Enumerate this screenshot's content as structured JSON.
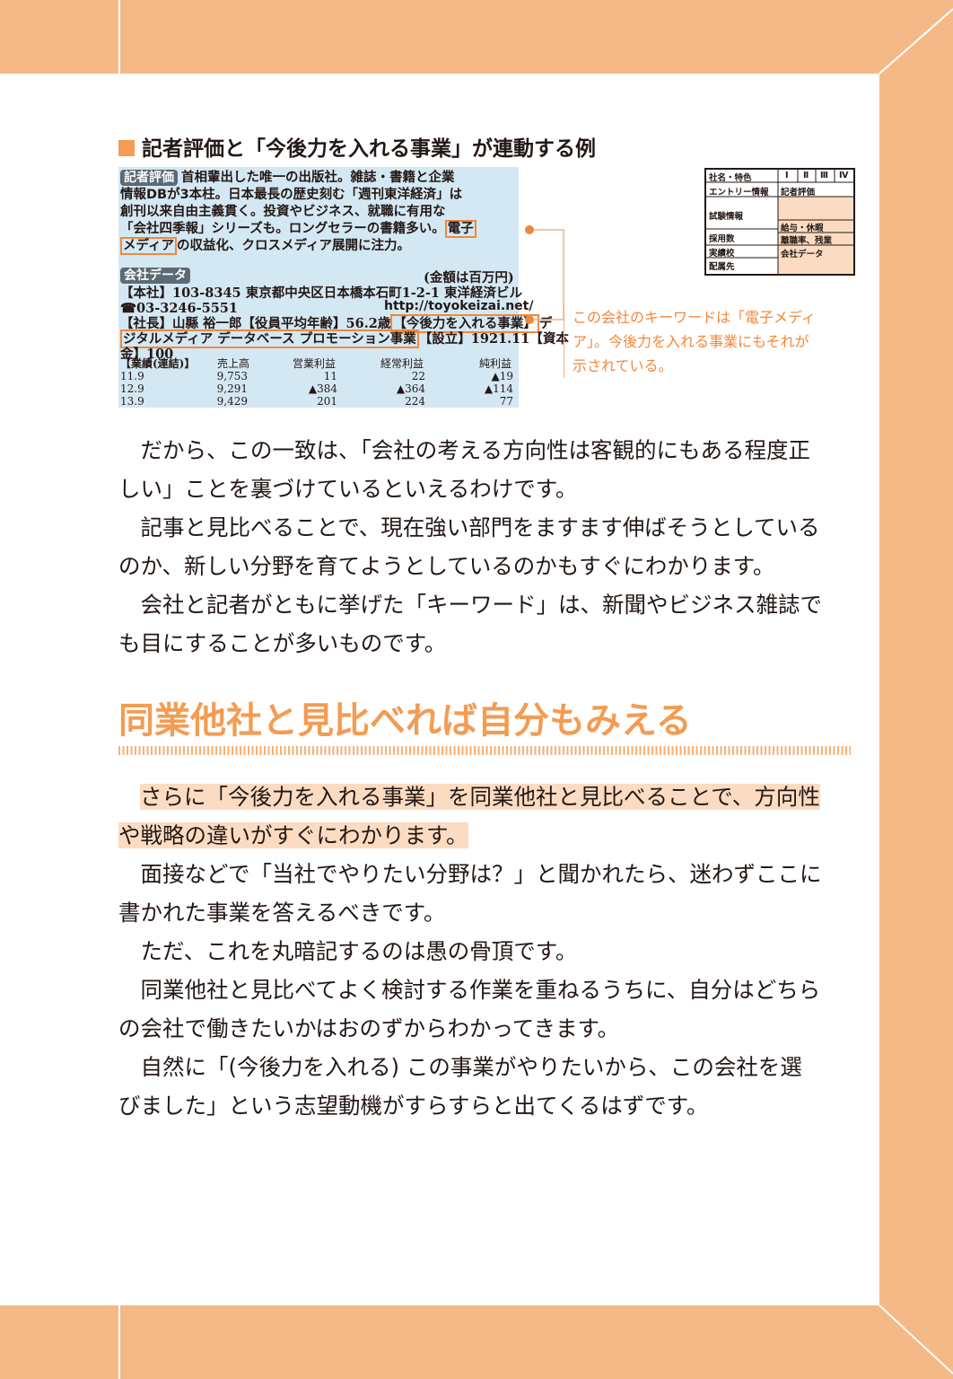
{
  "figure": {
    "heading": "記者評価と「今後力を入れる事業」が連動する例",
    "card": {
      "review_tag": "記者評価",
      "review_lines": [
        "首相輩出した唯一の出版社。雑誌・書籍と企業",
        "情報DBが3本柱。日本最長の歴史刻む「週刊東洋経済」は",
        "創刊以来自由主義貫く。投資やビジネス、就職に有用な",
        "「会社四季報」シリーズも。ロングセラーの書籍多い。",
        "電子",
        "メディア",
        "の収益化、クロスメディア展開に注力。"
      ],
      "data_tag": "会社データ",
      "unit_note": "(金額は百万円)",
      "hq": "【本社】103-8345 東京都中央区日本橋本石町1-2-1 東洋経済ビル",
      "phone": "☎03-3246-5551",
      "url": "http://toyokeizai.net/",
      "president": "【社長】山縣 裕一郎【役員平均年齢】56.2歳",
      "focus_label": "【今後力を入れる事業】",
      "focus_head": "デ",
      "focus_rest": "ジタルメディア データベース プロモーション事業",
      "founded": "【設立】1921.11【資本",
      "capital": "金】100",
      "fin_headers": [
        "【業績(連結)】",
        "売上高",
        "営業利益",
        "経常利益",
        "純利益"
      ],
      "fin_rows": [
        [
          "11.9",
          "9,753",
          "11",
          "22",
          "▲19"
        ],
        [
          "12.9",
          "9,291",
          "▲384",
          "▲364",
          "▲114"
        ],
        [
          "13.9",
          "9,429",
          "201",
          "224",
          "77"
        ]
      ]
    },
    "mini_table": {
      "row1": "社名・特色",
      "roman": [
        "Ⅰ",
        "Ⅱ",
        "Ⅲ",
        "Ⅳ"
      ],
      "row2": "エントリー情報",
      "row2b": "記者評価",
      "row3": "試験情報",
      "row3b": "給与・休暇",
      "row4": "採用数",
      "row4b": "離職率、残業",
      "row5": "実績校",
      "row5b": "会社データ",
      "row6": "配属先"
    },
    "caption": [
      "この会社のキーワードは「電子メディ",
      "ア」。今後力を入れる事業にもそれが",
      "示されている。"
    ]
  },
  "body": {
    "p1": [
      "　だから、この一致は、「会社の考える方向性は客観的にもある程度正",
      "しい」ことを裏づけているといえるわけです。"
    ],
    "p2": [
      "　記事と見比べることで、現在強い部門をますます伸ばそうとしている",
      "のか、新しい分野を育てようとしているのかもすぐにわかります。"
    ],
    "p3": [
      "　会社と記者がともに挙げた「キーワード」は、新聞やビジネス雑誌で",
      "も目にすることが多いものです。"
    ],
    "section_title": "同業他社と見比べれば自分もみえる",
    "p4": [
      "さらに「今後力を入れる事業」を同業他社と見比べることで、方向性",
      "や戦略の違いがすぐにわかります。"
    ],
    "p5": [
      "　面接などで「当社でやりたい分野は？」と聞かれたら、迷わずここに",
      "書かれた事業を答えるべきです。"
    ],
    "p6": [
      "　ただ、これを丸暗記するのは愚の骨頂です。"
    ],
    "p7": [
      "　同業他社と見比べてよく検討する作業を重ねるうちに、自分はどちら",
      "の会社で働きたいかはおのずからわかってきます。"
    ],
    "p8": [
      "　自然に「(今後力を入れる) この事業がやりたいから、この会社を選",
      "びました」という志望動機がすらすらと出てくるはずです。"
    ]
  },
  "colors": {
    "frame": "#f4b987",
    "accent": "#f39c53",
    "card": "#d4e8f4",
    "highlight": "#fbdcc2"
  }
}
